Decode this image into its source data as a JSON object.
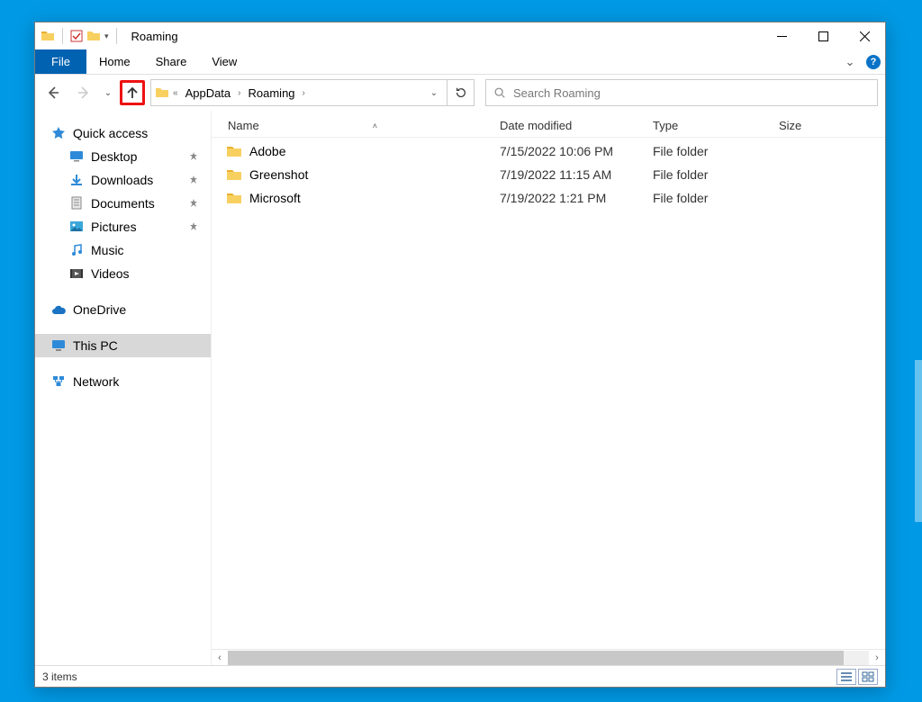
{
  "window": {
    "title": "Roaming"
  },
  "ribbon": {
    "file": "File",
    "tabs": [
      "Home",
      "Share",
      "View"
    ]
  },
  "address": {
    "crumbs": [
      "AppData",
      "Roaming"
    ]
  },
  "search": {
    "placeholder": "Search Roaming"
  },
  "navpane": {
    "quick_access": "Quick access",
    "quick_items": [
      {
        "label": "Desktop",
        "icon": "desktop",
        "pinned": true
      },
      {
        "label": "Downloads",
        "icon": "downloads",
        "pinned": true
      },
      {
        "label": "Documents",
        "icon": "documents",
        "pinned": true
      },
      {
        "label": "Pictures",
        "icon": "pictures",
        "pinned": true
      },
      {
        "label": "Music",
        "icon": "music",
        "pinned": false
      },
      {
        "label": "Videos",
        "icon": "videos",
        "pinned": false
      }
    ],
    "onedrive": "OneDrive",
    "thispc": "This PC",
    "network": "Network"
  },
  "columns": {
    "name": "Name",
    "date": "Date modified",
    "type": "Type",
    "size": "Size"
  },
  "rows": [
    {
      "name": "Adobe",
      "date": "7/15/2022 10:06 PM",
      "type": "File folder"
    },
    {
      "name": "Greenshot",
      "date": "7/19/2022 11:15 AM",
      "type": "File folder"
    },
    {
      "name": "Microsoft",
      "date": "7/19/2022 1:21 PM",
      "type": "File folder"
    }
  ],
  "status": {
    "text": "3 items"
  }
}
